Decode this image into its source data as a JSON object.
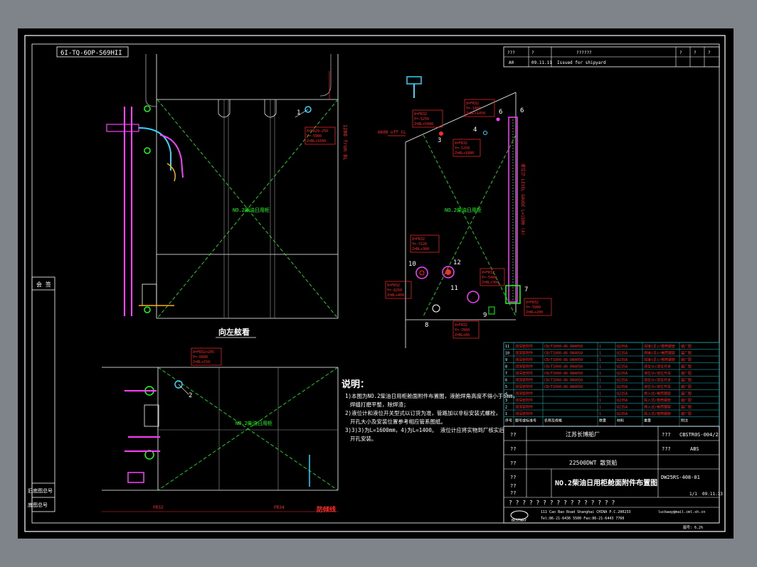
{
  "drawing": {
    "upside_label": "6I-TQ-6OP-S69HII",
    "view_label_left": "向左舷看",
    "tank_label_side": "NO.2柴油日用柜",
    "tank_label_front": "NO.2柴油日用柜",
    "tank_label_plan": "NO.2柴油日用柜",
    "waterline_label": "防倾线",
    "frame_labels": [
      "FR32",
      "FR34"
    ],
    "dim_label_vertical": "1200 from BL",
    "bl_label": "6600 off CL",
    "level_gauge_text": "液位计  LEVEL GAUGE L=1500 (A)"
  },
  "callouts": [
    {
      "id": "c1",
      "lines": [
        "X=FR29-250",
        "Y=-5900",
        "Z=BL+1600"
      ]
    },
    {
      "id": "c6",
      "lines": [
        "X=FR32",
        "Y=-1400",
        "Z=BL+1450"
      ]
    },
    {
      "id": "c5",
      "lines": [
        "X=FR32",
        "Y=-5250",
        "Z=BL+5480"
      ]
    },
    {
      "id": "c3",
      "lines": [
        "X=FR32",
        "Y=-5250",
        "Z=BL+1880"
      ]
    },
    {
      "id": "c12",
      "lines": [
        "X=FR32",
        "Y=-7220",
        "Z=BL+300"
      ]
    },
    {
      "id": "c11",
      "lines": [
        "X=FR32",
        "Y=-5400",
        "Z=BL+300"
      ]
    },
    {
      "id": "c10",
      "lines": [
        "X=FR32",
        "Y=-8250",
        "Z=BL+400"
      ]
    },
    {
      "id": "c7",
      "lines": [
        "X=FR32",
        "Y=-5900",
        "Z=BL+200"
      ]
    },
    {
      "id": "c8",
      "lines": [
        "X=FR32",
        "Y=-7800",
        "Z=BL+60"
      ]
    },
    {
      "id": "c2",
      "lines": [
        "X=FR32+205",
        "Y=-6890",
        "Z=BL+150"
      ]
    }
  ],
  "balloons": [
    "1",
    "2",
    "3",
    "4",
    "6",
    "6",
    "7",
    "8",
    "9",
    "10",
    "11",
    "12"
  ],
  "notes": {
    "title": "说明：",
    "items": [
      "1)本图为NO.2柴油日用柜舱面附件布置图，液舱焊角高度不得小于6mm，",
      "焊缝打磨平整，除焊渣；",
      "2)液位计和液位开关型式以订货为准，管路加以非标安装式螺栓，",
      "开孔大小及安装位置参考相应管系图纸。",
      "3)3)3)为L=1600mm，4)为L=1400。 液位计应将实物到厂核实后",
      "开孔安装。"
    ]
  },
  "revision_block": {
    "header": [
      "???",
      "?",
      "??????",
      "?",
      "?",
      "?",
      "?"
    ],
    "row": [
      "A0",
      "09.11.11",
      "Issued for shipyard"
    ]
  },
  "left_strip": {
    "top_label": "会 签",
    "mid_label": "旧底图总号",
    "bottom_label": "底图总号"
  },
  "parts_table": {
    "rows": [
      [
        "11",
        "测深管附件",
        "CB/T1000-86 DN4050",
        "1",
        "Q235A",
        "焊接(见)/卷筒钢管",
        "装厂配"
      ],
      [
        "10",
        "测深管附件",
        "CB/T1000-86 DN4050",
        "1",
        "Q235A",
        "焊接(见)/卷筒钢管",
        "装厂配"
      ],
      [
        "9",
        "测深管附件",
        "CB/T1000-86 DN4050",
        "1",
        "Q235A",
        "焊接(见)/卷筒钢管",
        "装厂配"
      ],
      [
        "8",
        "测深管附件",
        "CB/T1000-86 DN4050",
        "1",
        "Q235A",
        "液位计/液位开关",
        "装厂配"
      ],
      [
        "7",
        "测深管附件",
        "CB/T1000-86 DN4050",
        "1",
        "Q235A",
        "液位计/液位开关",
        "装厂配"
      ],
      [
        "6",
        "测深管附件",
        "CB/T1000-86 DN4050",
        "1",
        "Q235A",
        "液位计/液位开关",
        "装厂配"
      ],
      [
        "5",
        "测深管附件",
        "CB/T1000-86 DN4050",
        "1",
        "Q235A",
        "液位计/液位开关",
        "装厂配"
      ],
      [
        "4",
        "测深管附件",
        "",
        "1",
        "Q235A",
        "焊入式/卷筒钢管",
        "装厂配"
      ],
      [
        "3",
        "测深管附件",
        "",
        "1",
        "Q235A",
        "焊入式/卷筒钢管",
        "装厂配"
      ],
      [
        "2",
        "测深管附件",
        "",
        "1",
        "Q235A",
        "焊入式/卷筒钢管",
        "装厂配"
      ],
      [
        "1",
        "测深管附件",
        "",
        "1",
        "Q235A",
        "焊入式/卷筒钢管",
        "装厂配"
      ]
    ],
    "footer": [
      "序号",
      "图号或标准号",
      "名称及规格",
      "数量",
      "材料",
      "重量",
      "附注"
    ]
  },
  "title_block": {
    "shipyard": "江苏长博船厂",
    "doc_code": "CBSTR0S-004/2",
    "class": "ABS",
    "ship_type": "22500DWT 散货船",
    "drawing_title": "NO.2柴油日用柜舱面附件布置图",
    "drawing_no": "DW25RS-408-01",
    "sheet": "1/1",
    "date": "09.11.13",
    "scale": "图号: 6.2%",
    "q": "?",
    "qqq": "???",
    "qq": "??",
    "stamp_row": "? ? ? ? ? ? ? ? ? ? ? ? ? ? ? ?",
    "company": "BESTWAY",
    "address_1": "111 Cao Bao Road Shanghai CHINA   P.C.200233",
    "address_2": "Tel:86-21-6436 5500   Fax:86-21-6443 7760",
    "email": "luckway@mail.cml.sh.cn"
  },
  "colors": {
    "background": "#000000",
    "frame": "#ffffff",
    "dim_red": "#ff2a2a",
    "centerline_green": "#19ff19",
    "pipe_magenta": "#ff3dff",
    "pipe_cyan": "#2fd6ff",
    "table_cyan": "#1fbfbf"
  }
}
